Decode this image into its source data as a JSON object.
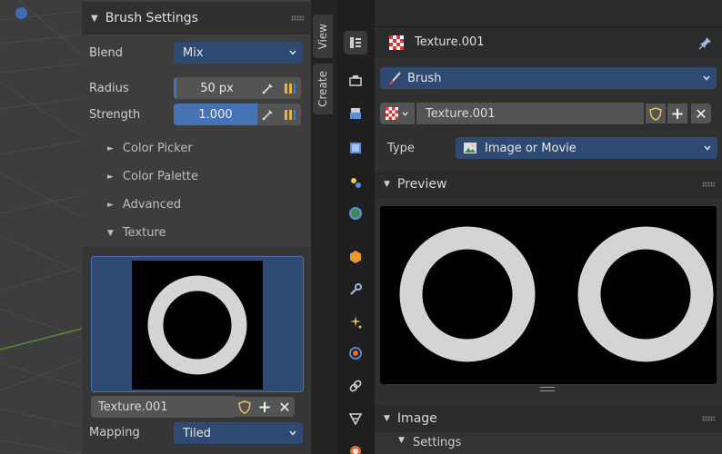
{
  "left_panel": {
    "title": "Brush Settings",
    "blend_label": "Blend",
    "blend_value": "Mix",
    "radius_label": "Radius",
    "radius_value": "50 px",
    "strength_label": "Strength",
    "strength_value": "1.000",
    "strength_fraction": 1.0,
    "subpanels": [
      "Color Picker",
      "Color Palette",
      "Advanced",
      "Texture"
    ],
    "texture_name": "Texture.001",
    "mapping_label": "Mapping",
    "mapping_value": "Tiled"
  },
  "tabs": {
    "view": "View",
    "create": "Create"
  },
  "properties": {
    "header_title": "Texture.001",
    "brush_value": "Brush",
    "texture_value": "Texture.001",
    "type_label": "Type",
    "type_value": "Image or Movie",
    "preview_label": "Preview",
    "image_label": "Image",
    "settings_label": "Settings"
  },
  "colors": {
    "accent_blue": "#4772b3",
    "field_blue": "#2e4a73",
    "panel_bg": "#3d3d3d",
    "header_bg": "#303030",
    "ring": "#d4d4d4"
  },
  "icons": [
    "brush-settings-icon",
    "eyedropper-icon",
    "pressure-icon",
    "checker-texture-icon",
    "pin-icon",
    "fake-user-shield-icon",
    "plus-icon",
    "close-icon",
    "image-icon",
    "tool-icon",
    "render-icon",
    "output-icon",
    "view-layer-icon",
    "scene-icon",
    "world-icon",
    "object-icon",
    "modifier-icon",
    "particles-icon",
    "physics-icon",
    "constraint-icon",
    "data-icon",
    "material-icon"
  ]
}
